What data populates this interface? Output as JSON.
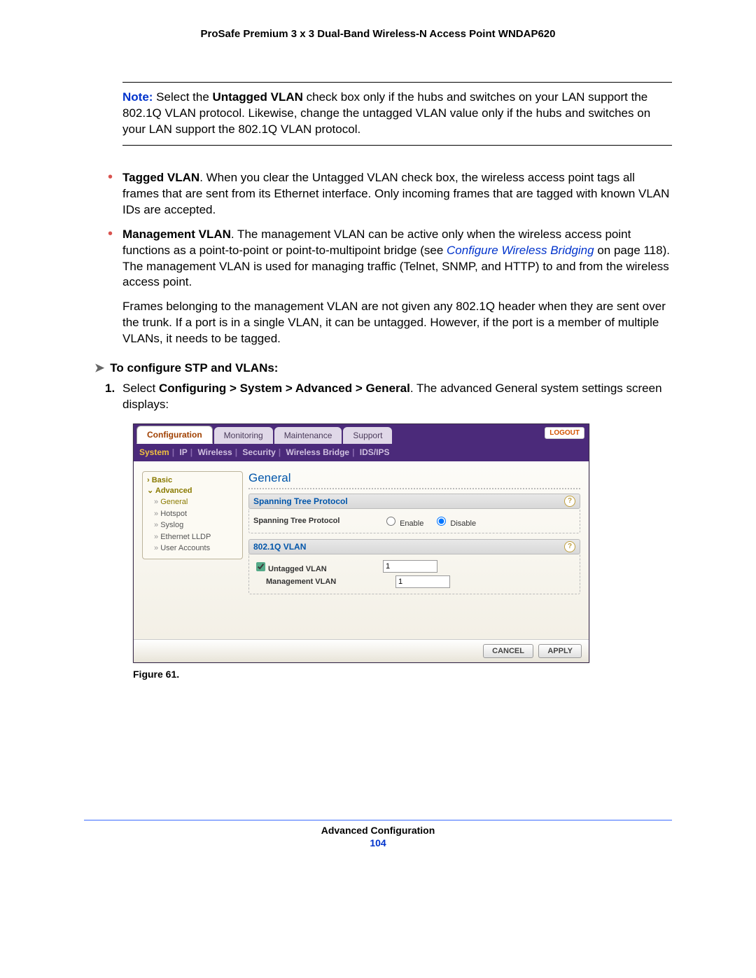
{
  "header": {
    "title": "ProSafe Premium 3 x 3 Dual-Band Wireless-N Access Point WNDAP620"
  },
  "note": {
    "label": "Note:",
    "text_pre": " Select the ",
    "bold": "Untagged VLAN",
    "text_post": " check box only if the hubs and switches on your LAN support the 802.1Q VLAN protocol. Likewise, change the untagged VLAN value only if the hubs and switches on your LAN support the 802.1Q VLAN protocol."
  },
  "bullets": [
    {
      "head": "Tagged VLAN",
      "body": ". When you clear the Untagged VLAN check box, the wireless access point tags all frames that are sent from its Ethernet interface. Only incoming frames that are tagged with known VLAN IDs are accepted."
    },
    {
      "head": "Management VLAN",
      "body_a": ". The management VLAN can be active only when the wireless access point functions as a point-to-point or point-to-multipoint bridge (see ",
      "link": "Configure Wireless Bridging",
      "body_b": " on page 118). The management VLAN is used for managing traffic (Telnet, SNMP, and HTTP) to and from the wireless access point."
    }
  ],
  "indent_para": "Frames belonging to the management VLAN are not given any 802.1Q header when they are sent over the trunk. If a port is in a single VLAN, it can be untagged. However, if the port is a member of multiple VLANs, it needs to be tagged.",
  "task_head": "To configure STP and VLANs:",
  "step1": {
    "num": "1.",
    "pre": "Select ",
    "bold": "Configuring > System > Advanced > General",
    "post": ". The advanced General system settings screen displays:"
  },
  "ui": {
    "toptabs": [
      "Configuration",
      "Monitoring",
      "Maintenance",
      "Support"
    ],
    "active_tab": 0,
    "logout": "LOGOUT",
    "subnav": [
      "System",
      "IP",
      "Wireless",
      "Security",
      "Wireless Bridge",
      "IDS/IPS"
    ],
    "subnav_selected": 0,
    "side": {
      "basic": "Basic",
      "advanced": "Advanced",
      "subs": [
        "General",
        "Hotspot",
        "Syslog",
        "Ethernet LLDP",
        "User Accounts"
      ],
      "sub_selected": 0
    },
    "section_title": "General",
    "panel1": {
      "title": "Spanning Tree Protocol",
      "row_label": "Spanning Tree Protocol",
      "enable": "Enable",
      "disable": "Disable",
      "selected": "disable"
    },
    "panel2": {
      "title": "802.1Q VLAN",
      "untagged_label": "Untagged VLAN",
      "untagged_value": "1",
      "untagged_checked": true,
      "mgmt_label": "Management VLAN",
      "mgmt_value": "1"
    },
    "buttons": {
      "cancel": "CANCEL",
      "apply": "APPLY"
    }
  },
  "figure": "Figure 61.",
  "footer": {
    "section": "Advanced Configuration",
    "page": "104"
  }
}
